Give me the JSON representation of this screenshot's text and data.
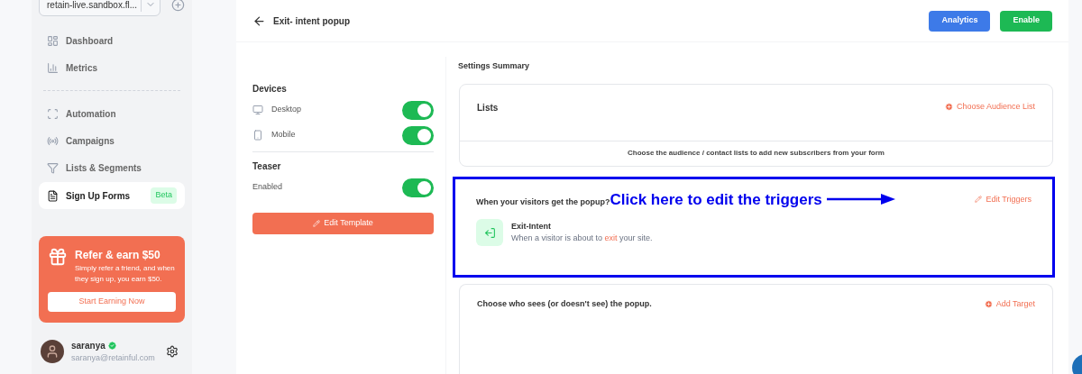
{
  "sidebar": {
    "account": "retain-live.sandbox.fl...",
    "nav": [
      {
        "label": "Dashboard",
        "kind": "dashboard",
        "selected": false
      },
      {
        "label": "Metrics",
        "kind": "metrics",
        "selected": false
      },
      {
        "label": "Automation",
        "kind": "automation",
        "selected": false
      },
      {
        "label": "Campaigns",
        "kind": "campaigns",
        "selected": false
      },
      {
        "label": "Lists & Segments",
        "kind": "lists",
        "selected": false
      },
      {
        "label": "Sign Up Forms",
        "kind": "forms",
        "selected": true,
        "badge": "Beta"
      }
    ],
    "promo": {
      "title": "Refer & earn $50",
      "text": "Simply refer a friend, and when they sign up, you earn $50.",
      "button": "Start Earning Now"
    },
    "user": {
      "name": "saranya",
      "email": "saranya@retainful.com",
      "verified": true
    }
  },
  "header": {
    "title": "Exit- intent popup",
    "buttons": [
      {
        "label": "Analytics",
        "kind": "primary"
      },
      {
        "label": "Enable",
        "kind": "success"
      }
    ]
  },
  "settings": {
    "groups": [
      {
        "title": "Devices",
        "rows": [
          {
            "label": "Desktop",
            "kind": "desktop",
            "on": true
          },
          {
            "label": "Mobile",
            "kind": "mobile",
            "on": true
          }
        ]
      },
      {
        "title": "Teaser",
        "rows": [
          {
            "label": "Enabled",
            "on": true
          }
        ]
      }
    ],
    "edit_button": "Edit Template"
  },
  "summary": {
    "title": "Settings Summary",
    "lists": {
      "title": "Lists",
      "action": "Choose Audience List",
      "note": "Choose the audience / contact lists to add new subscribers from your form"
    },
    "triggers": {
      "title": "When your visitors get the popup?",
      "action": "Edit Triggers",
      "annotation": "Click here to edit the triggers",
      "item": {
        "title": "Exit-Intent",
        "description": [
          {
            "text": "When a visitor is about to ",
            "accent": false
          },
          {
            "text": "exit",
            "accent": true
          },
          {
            "text": " your site.",
            "accent": false
          }
        ]
      }
    },
    "targeting": {
      "title": "Choose who sees (or doesn't see) the popup.",
      "action": "Add Target"
    }
  }
}
